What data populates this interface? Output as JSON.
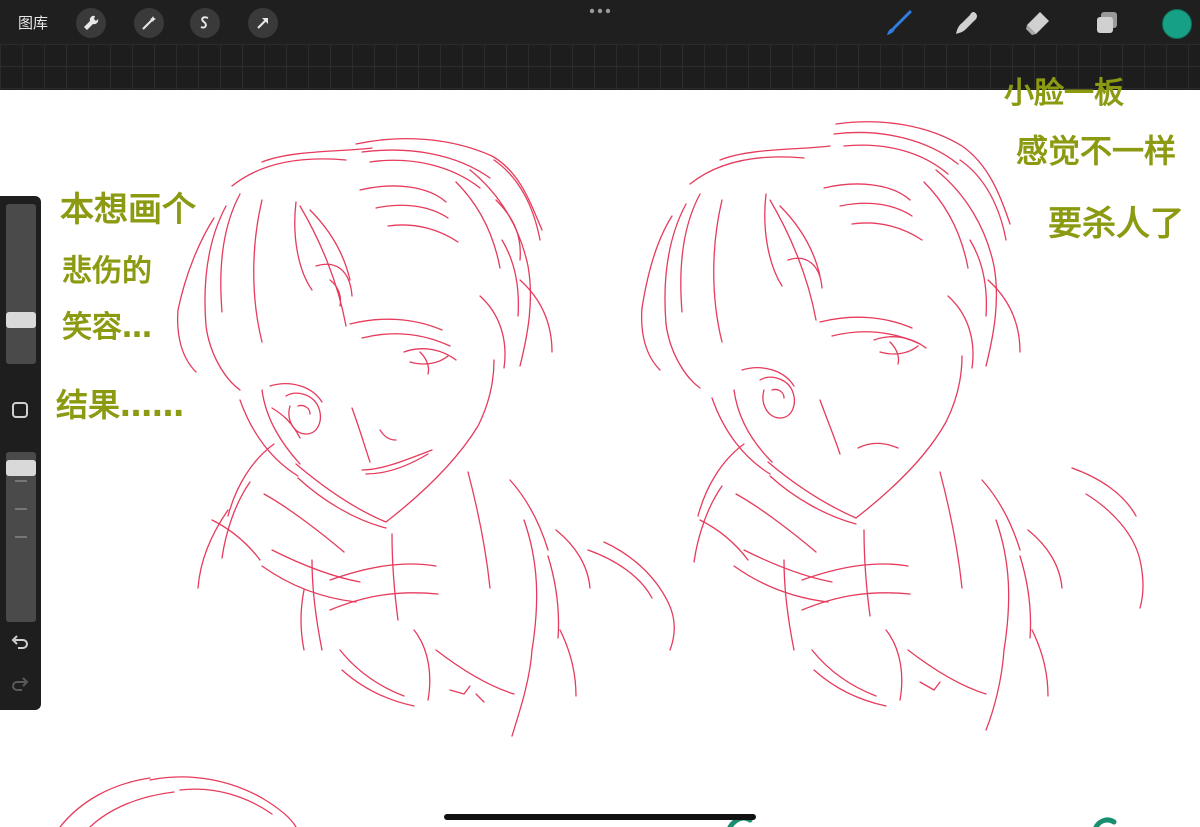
{
  "topbar": {
    "gallery_label": "图库",
    "left_tools": [
      "wrench-icon",
      "magic-wand-icon",
      "selection-icon",
      "move-arrow-icon"
    ],
    "right_tools": [
      "brush-icon",
      "smudge-icon",
      "eraser-icon",
      "layers-icon"
    ],
    "active_tool": "brush-icon",
    "current_color": "#16a085"
  },
  "sidebar": {
    "brush_size_fraction": 0.25,
    "opacity_fraction": 0.95,
    "icons": [
      "modify-square-icon",
      "undo-icon",
      "redo-icon"
    ]
  },
  "annotations": {
    "left_note_line1": "本想画个",
    "left_note_line2": "悲伤的",
    "left_note_line3": "笑容…",
    "left_note_line4": "结果……",
    "right_note_line1": "小脸一板",
    "right_note_line2": "感觉不一样",
    "right_note_line3": "要杀人了"
  },
  "colors": {
    "sketch_stroke": "#e63b5c",
    "note_text": "#8c9a12",
    "toolbar_bg": "#1f1f1f",
    "active_brush": "#2f7de1"
  }
}
